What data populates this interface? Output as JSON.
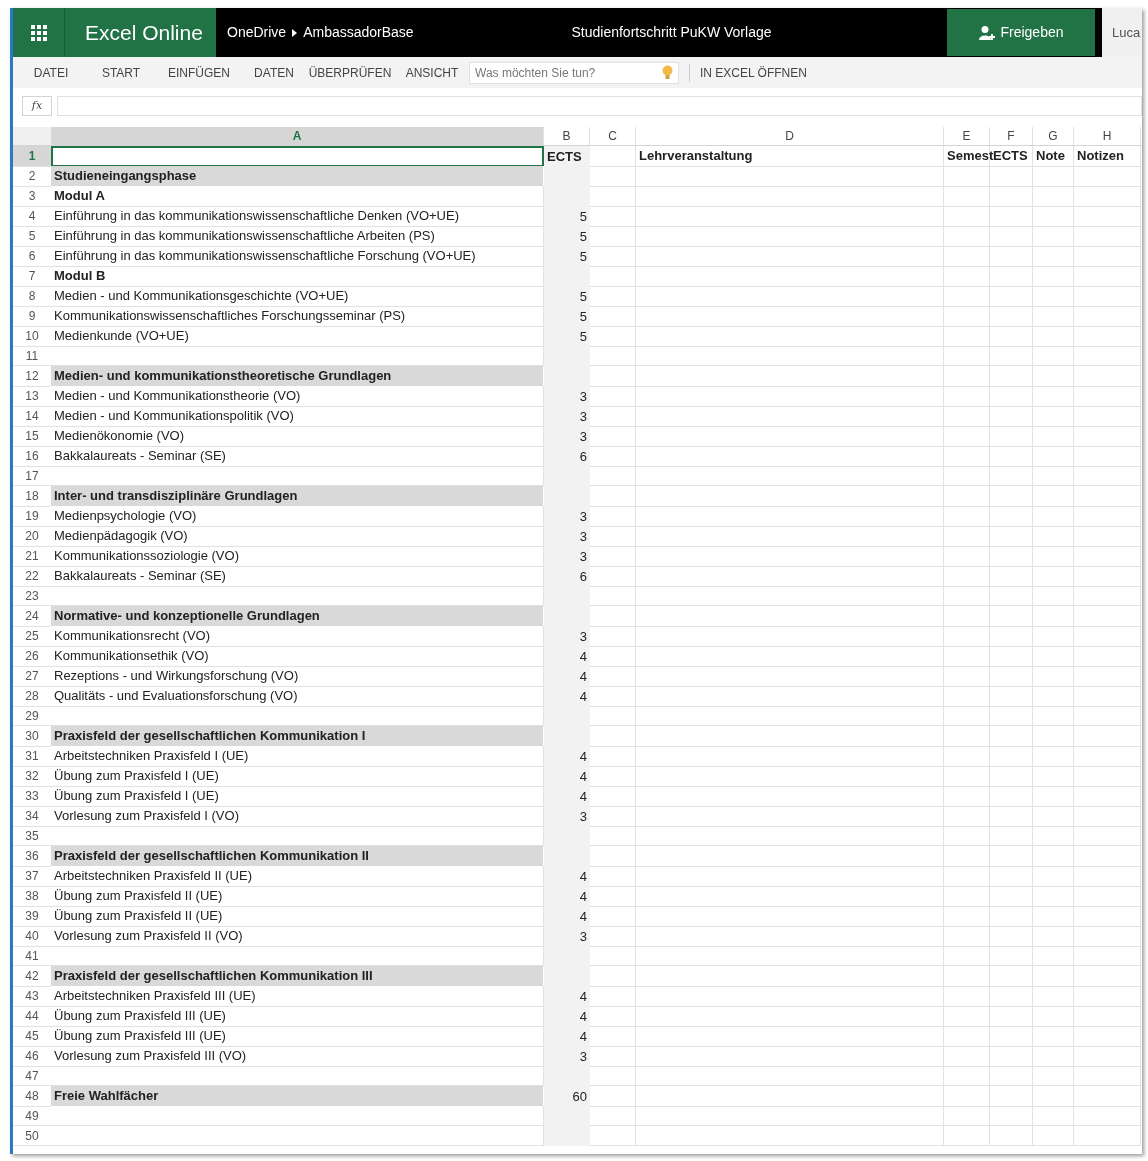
{
  "app_bar": {
    "product": "Excel Online",
    "breadcrumb": [
      "OneDrive",
      "AmbassadorBase"
    ],
    "document_title": "Studienfortschritt PuKW Vorlage",
    "share_button": "Freigeben",
    "user": "Luca"
  },
  "ribbon": {
    "tabs": [
      {
        "label": "DATEI"
      },
      {
        "label": "START"
      },
      {
        "label": "EINFÜGEN"
      },
      {
        "label": "DATEN"
      },
      {
        "label": "ÜBERPRÜFEN"
      },
      {
        "label": "ANSICHT"
      }
    ],
    "search": {
      "placeholder": "Was möchten Sie tun?"
    },
    "open_in_app": "IN EXCEL ÖFFNEN"
  },
  "formula_bar": {
    "function_label": "fx"
  },
  "sheet": {
    "columns": [
      {
        "label": "A",
        "selected": true
      },
      {
        "label": "B",
        "selected": false
      },
      {
        "label": "C",
        "selected": false
      },
      {
        "label": "D",
        "selected": false
      },
      {
        "label": "E",
        "selected": false
      },
      {
        "label": "F",
        "selected": false
      },
      {
        "label": "G",
        "selected": false
      },
      {
        "label": "H",
        "selected": false
      }
    ],
    "rows": [
      {
        "number": "1",
        "kind": "header",
        "selected": true,
        "cells": {
          "B": "ECTS",
          "D": "Lehrveranstaltung",
          "E": "Semest",
          "F": "ECTS",
          "G": "Note",
          "H": "Notizen"
        }
      },
      {
        "number": "2",
        "kind": "section",
        "selected": false,
        "course": "Studieneingangsphase"
      },
      {
        "number": "3",
        "kind": "module",
        "selected": false,
        "course": "Modul A"
      },
      {
        "number": "4",
        "kind": "item",
        "selected": false,
        "course": "Einführung in das kommunikationswissenschaftliche Denken (VO+UE)",
        "ects": "5"
      },
      {
        "number": "5",
        "kind": "item",
        "selected": false,
        "course": "Einführung in das kommunikationswissenschaftliche Arbeiten (PS)",
        "ects": "5"
      },
      {
        "number": "6",
        "kind": "item",
        "selected": false,
        "course": "Einführung in das kommunikationswissenschaftliche Forschung (VO+UE)",
        "ects": "5"
      },
      {
        "number": "7",
        "kind": "module",
        "selected": false,
        "course": "Modul B"
      },
      {
        "number": "8",
        "kind": "item",
        "selected": false,
        "course": "Medien - und Kommunikationsgeschichte (VO+UE)",
        "ects": "5"
      },
      {
        "number": "9",
        "kind": "item",
        "selected": false,
        "course": "Kommunikationswissenschaftliches Forschungsseminar (PS)",
        "ects": "5"
      },
      {
        "number": "10",
        "kind": "item",
        "selected": false,
        "course": "Medienkunde (VO+UE)",
        "ects": "5"
      },
      {
        "number": "11",
        "kind": "blank",
        "selected": false
      },
      {
        "number": "12",
        "kind": "section",
        "selected": false,
        "course": "Medien- und kommunikationstheoretische Grundlagen"
      },
      {
        "number": "13",
        "kind": "item",
        "selected": false,
        "course": "Medien - und Kommunikationstheorie (VO)",
        "ects": "3"
      },
      {
        "number": "14",
        "kind": "item",
        "selected": false,
        "course": "Medien - und Kommunikationspolitik (VO)",
        "ects": "3"
      },
      {
        "number": "15",
        "kind": "item",
        "selected": false,
        "course": "Medienökonomie (VO)",
        "ects": "3"
      },
      {
        "number": "16",
        "kind": "item",
        "selected": false,
        "course": "Bakkalaureats - Seminar (SE)",
        "ects": "6"
      },
      {
        "number": "17",
        "kind": "blank",
        "selected": false
      },
      {
        "number": "18",
        "kind": "section",
        "selected": false,
        "course": "Inter- und transdisziplinäre Grundlagen"
      },
      {
        "number": "19",
        "kind": "item",
        "selected": false,
        "course": "Medienpsychologie (VO)",
        "ects": "3"
      },
      {
        "number": "20",
        "kind": "item",
        "selected": false,
        "course": "Medienpädagogik (VO)",
        "ects": "3"
      },
      {
        "number": "21",
        "kind": "item",
        "selected": false,
        "course": "Kommunikationssoziologie (VO)",
        "ects": "3"
      },
      {
        "number": "22",
        "kind": "item",
        "selected": false,
        "course": "Bakkalaureats - Seminar (SE)",
        "ects": "6"
      },
      {
        "number": "23",
        "kind": "blank",
        "selected": false
      },
      {
        "number": "24",
        "kind": "section",
        "selected": false,
        "course": "Normative- und konzeptionelle Grundlagen"
      },
      {
        "number": "25",
        "kind": "item",
        "selected": false,
        "course": "Kommunikationsrecht (VO)",
        "ects": "3"
      },
      {
        "number": "26",
        "kind": "item",
        "selected": false,
        "course": "Kommunikationsethik (VO)",
        "ects": "4"
      },
      {
        "number": "27",
        "kind": "item",
        "selected": false,
        "course": "Rezeptions - und Wirkungsforschung (VO)",
        "ects": "4"
      },
      {
        "number": "28",
        "kind": "item",
        "selected": false,
        "course": "Qualitäts - und Evaluationsforschung (VO)",
        "ects": "4"
      },
      {
        "number": "29",
        "kind": "blank",
        "selected": false
      },
      {
        "number": "30",
        "kind": "section",
        "selected": false,
        "course": "Praxisfeld der gesellschaftlichen Kommunikation I"
      },
      {
        "number": "31",
        "kind": "item",
        "selected": false,
        "course": "Arbeitstechniken Praxisfeld I (UE)",
        "ects": "4"
      },
      {
        "number": "32",
        "kind": "item",
        "selected": false,
        "course": "Übung zum Praxisfeld I (UE)",
        "ects": "4"
      },
      {
        "number": "33",
        "kind": "item",
        "selected": false,
        "course": "Übung zum Praxisfeld I (UE)",
        "ects": "4"
      },
      {
        "number": "34",
        "kind": "item",
        "selected": false,
        "course": "Vorlesung zum Praxisfeld I (VO)",
        "ects": "3"
      },
      {
        "number": "35",
        "kind": "blank",
        "selected": false
      },
      {
        "number": "36",
        "kind": "section",
        "selected": false,
        "course": "Praxisfeld der gesellschaftlichen Kommunikation II"
      },
      {
        "number": "37",
        "kind": "item",
        "selected": false,
        "course": "Arbeitstechniken Praxisfeld II (UE)",
        "ects": "4"
      },
      {
        "number": "38",
        "kind": "item",
        "selected": false,
        "course": "Übung zum Praxisfeld II (UE)",
        "ects": "4"
      },
      {
        "number": "39",
        "kind": "item",
        "selected": false,
        "course": "Übung zum Praxisfeld II (UE)",
        "ects": "4"
      },
      {
        "number": "40",
        "kind": "item",
        "selected": false,
        "course": "Vorlesung zum Praxisfeld II (VO)",
        "ects": "3"
      },
      {
        "number": "41",
        "kind": "blank",
        "selected": false
      },
      {
        "number": "42",
        "kind": "section",
        "selected": false,
        "course": "Praxisfeld der gesellschaftlichen Kommunikation III"
      },
      {
        "number": "43",
        "kind": "item",
        "selected": false,
        "course": "Arbeitstechniken Praxisfeld III (UE)",
        "ects": "4"
      },
      {
        "number": "44",
        "kind": "item",
        "selected": false,
        "course": "Übung zum Praxisfeld III (UE)",
        "ects": "4"
      },
      {
        "number": "45",
        "kind": "item",
        "selected": false,
        "course": "Übung zum Praxisfeld III (UE)",
        "ects": "4"
      },
      {
        "number": "46",
        "kind": "item",
        "selected": false,
        "course": "Vorlesung zum Praxisfeld III (VO)",
        "ects": "3"
      },
      {
        "number": "47",
        "kind": "blank",
        "selected": false
      },
      {
        "number": "48",
        "kind": "section",
        "selected": false,
        "course": "Freie Wahlfächer",
        "ects": "60"
      },
      {
        "number": "49",
        "kind": "blank",
        "selected": false
      },
      {
        "number": "50",
        "kind": "blank",
        "selected": false
      }
    ]
  }
}
